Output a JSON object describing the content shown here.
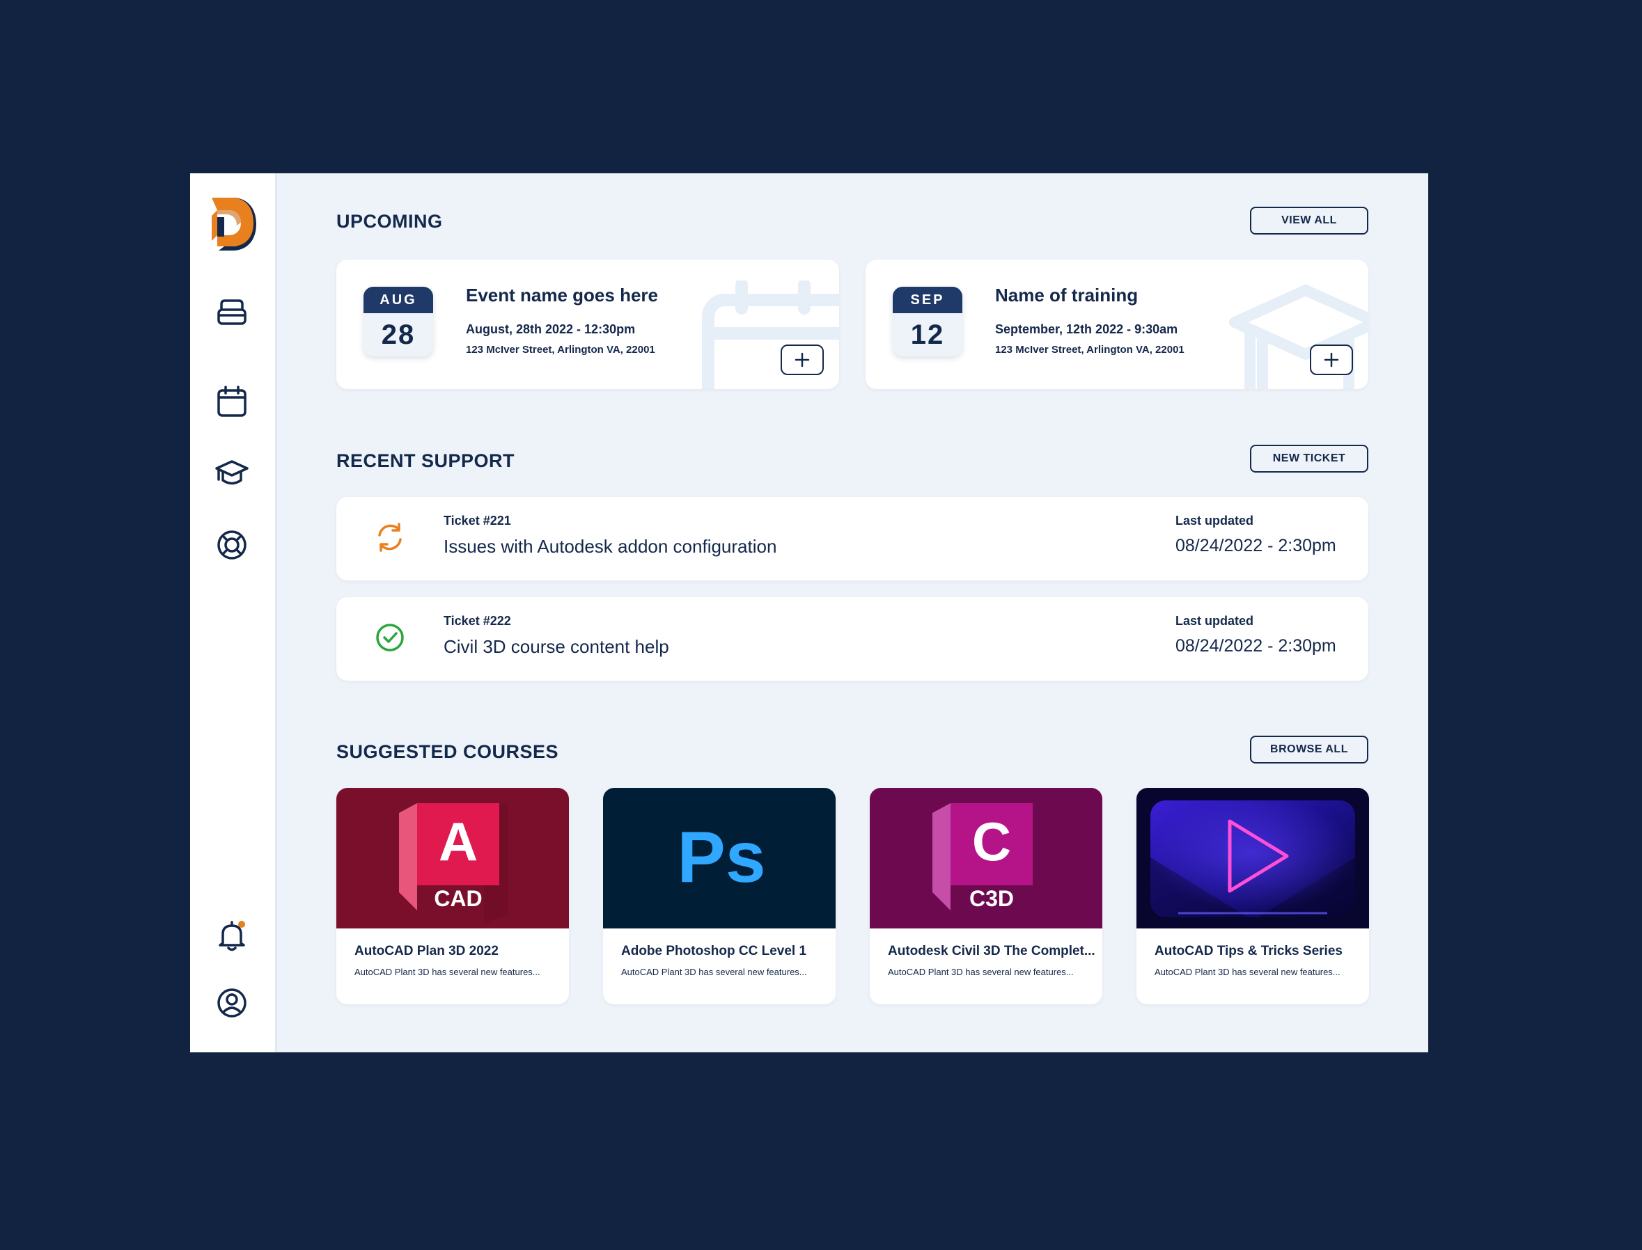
{
  "sidebar": {
    "logo_letter": "D",
    "nav": [
      {
        "icon": "inbox-tray-icon"
      },
      {
        "icon": "calendar-icon"
      },
      {
        "icon": "graduation-cap-icon"
      },
      {
        "icon": "lifebuoy-icon"
      }
    ],
    "bottom": [
      {
        "icon": "bell-icon",
        "has_notification": true
      },
      {
        "icon": "user-circle-icon"
      }
    ]
  },
  "upcoming": {
    "title": "UPCOMING",
    "button_label": "VIEW ALL",
    "events": [
      {
        "month": "AUG",
        "day": "28",
        "name": "Event name goes here",
        "when": "August, 28th 2022 - 12:30pm",
        "where": "123 McIver Street, Arlington VA, 22001",
        "watermark_icon": "calendar-icon"
      },
      {
        "month": "SEP",
        "day": "12",
        "name": "Name of training",
        "when": "September, 12th 2022 - 9:30am",
        "where": "123 McIver Street, Arlington VA, 22001",
        "watermark_icon": "graduation-cap-icon"
      }
    ]
  },
  "support": {
    "title": "RECENT SUPPORT",
    "button_label": "NEW TICKET",
    "tickets": [
      {
        "number": "Ticket #221",
        "subject": "Issues with Autodesk addon configuration",
        "updated_label": "Last updated",
        "updated": "08/24/2022 - 2:30pm",
        "status_icon": "refresh-icon",
        "status_color": "#e8801e"
      },
      {
        "number": "Ticket #222",
        "subject": "Civil 3D course content help",
        "updated_label": "Last updated",
        "updated": "08/24/2022 - 2:30pm",
        "status_icon": "check-circle-icon",
        "status_color": "#2aa63c"
      }
    ]
  },
  "courses": {
    "title": "SUGGESTED COURSES",
    "button_label": "BROWSE ALL",
    "items": [
      {
        "title": "AutoCAD Plan 3D 2022",
        "desc": "AutoCAD Plant 3D has several new features...",
        "thumb_letter": "A",
        "thumb_caption": "CAD"
      },
      {
        "title": "Adobe Photoshop CC Level 1",
        "desc": "AutoCAD Plant 3D has several new features...",
        "thumb_letter": "Ps"
      },
      {
        "title": "Autodesk Civil 3D The Complet...",
        "desc": "AutoCAD Plant 3D has several new features...",
        "thumb_letter": "C",
        "thumb_caption": "C3D"
      },
      {
        "title": "AutoCAD Tips & Tricks Series",
        "desc": "AutoCAD Plant 3D has several new features...",
        "thumb_icon": "play-icon"
      }
    ]
  },
  "colors": {
    "background": "#112340",
    "navy": "#14284b",
    "accent_orange": "#e8801e",
    "success_green": "#2aa63c",
    "autocad_red": "#7a0f2c",
    "photoshop_navy": "#001e36",
    "photoshop_blue": "#31a8ff",
    "civil3d_purple": "#6d0a4f"
  }
}
